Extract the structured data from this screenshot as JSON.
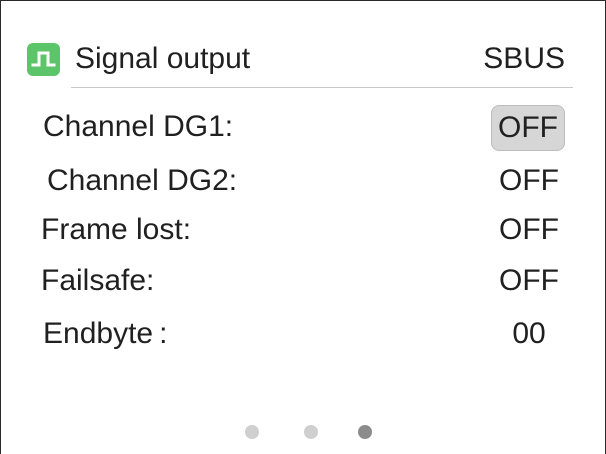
{
  "header": {
    "icon": "square-wave-icon",
    "title": "Signal output",
    "value": "SBUS"
  },
  "rows": [
    {
      "label": "Channel DG1:",
      "value": "OFF",
      "selected": true
    },
    {
      "label": "Channel DG2:",
      "value": "OFF",
      "selected": false
    },
    {
      "label": "Frame lost:",
      "value": "OFF",
      "selected": false
    },
    {
      "label": "Failsafe:",
      "value": "OFF",
      "selected": false
    },
    {
      "label": "Endbyte :",
      "value": "00",
      "selected": false
    }
  ],
  "pagination": {
    "total": 3,
    "current": 3
  },
  "colors": {
    "icon_bg": "#5cc56a",
    "selected_bg": "#d6d6d6",
    "dot_inactive": "#cfcfcf",
    "dot_active": "#8c8c8c"
  }
}
